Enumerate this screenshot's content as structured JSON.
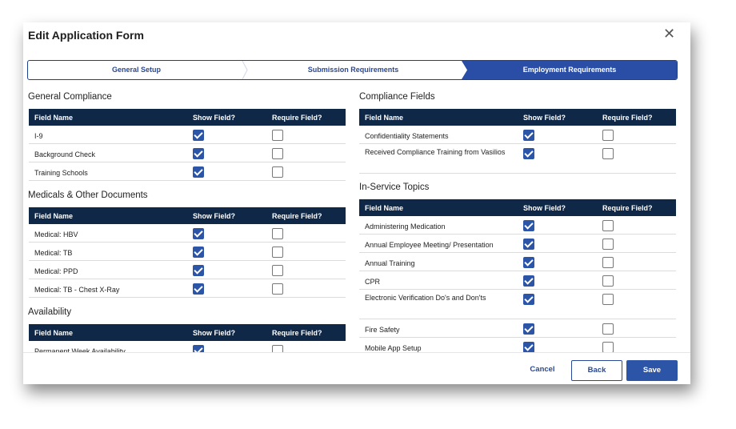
{
  "modal": {
    "title": "Edit Application Form",
    "close_icon": "close-icon"
  },
  "steps": [
    {
      "label": "General Setup",
      "active": false
    },
    {
      "label": "Submission Requirements",
      "active": false
    },
    {
      "label": "Employment Requirements",
      "active": true
    }
  ],
  "colors": {
    "header_bg": "#0f2848",
    "accent": "#2c55a8",
    "step_active": "#2a4da6"
  },
  "columns": {
    "field_name": "Field Name",
    "show_field": "Show Field?",
    "require_field": "Require Field?"
  },
  "left": {
    "general_compliance": {
      "title": "General Compliance",
      "rows": [
        {
          "name": "I-9",
          "show": true,
          "require": false
        },
        {
          "name": "Background Check",
          "show": true,
          "require": false
        },
        {
          "name": "Training Schools",
          "show": true,
          "require": false
        }
      ]
    },
    "medicals": {
      "title": "Medicals & Other Documents",
      "rows": [
        {
          "name": "Medical: HBV",
          "show": true,
          "require": false
        },
        {
          "name": "Medical: TB",
          "show": true,
          "require": false
        },
        {
          "name": "Medical: PPD",
          "show": true,
          "require": false
        },
        {
          "name": "Medical: TB - Chest X-Ray",
          "show": true,
          "require": false
        }
      ]
    },
    "availability": {
      "title": "Availability",
      "rows": [
        {
          "name": "Permanent Week Availability",
          "show": true,
          "require": false
        }
      ]
    }
  },
  "right": {
    "compliance_fields": {
      "title": "Compliance Fields",
      "rows": [
        {
          "name": "Confidentiality Statements",
          "show": true,
          "require": false
        },
        {
          "name": "Received Compliance Training from Vasilios",
          "show": true,
          "require": false
        }
      ]
    },
    "in_service": {
      "title": "In-Service Topics",
      "rows": [
        {
          "name": "Administering Medication",
          "show": true,
          "require": false
        },
        {
          "name": "Annual Employee Meeting/ Presentation",
          "show": true,
          "require": false
        },
        {
          "name": "Annual Training",
          "show": true,
          "require": false
        },
        {
          "name": "CPR",
          "show": true,
          "require": false
        },
        {
          "name": "Electronic Verification Do's and Don'ts",
          "show": true,
          "require": false
        },
        {
          "name": "Fire Safety",
          "show": true,
          "require": false
        },
        {
          "name": "Mobile App Setup",
          "show": true,
          "require": false
        },
        {
          "name": "",
          "show": true,
          "require": false
        }
      ]
    }
  },
  "footer": {
    "cancel": "Cancel",
    "back": "Back",
    "save": "Save"
  }
}
